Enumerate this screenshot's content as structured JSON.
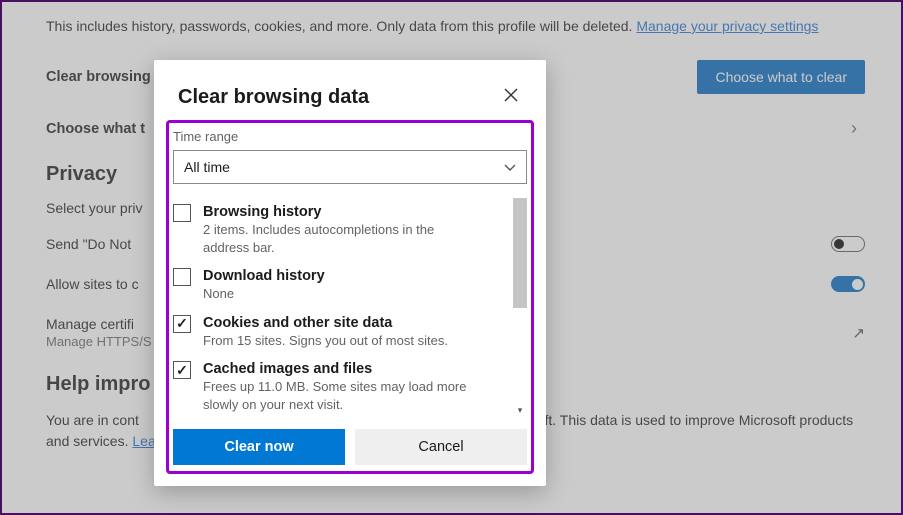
{
  "page": {
    "intro_text": "This includes history, passwords, cookies, and more. Only data from this profile will be deleted. ",
    "intro_link": "Manage your privacy settings",
    "row1_label": "Clear browsing",
    "row1_button": "Choose what to clear",
    "row2_label": "Choose what t",
    "privacy_heading": "Privacy",
    "privacy_sub": "Select your priv",
    "dnt_label": "Send \"Do Not ",
    "allow_label": "Allow sites to c",
    "manage_cert_label": "Manage certifi",
    "manage_cert_desc": "Manage HTTPS/S",
    "improve_heading": "Help impro",
    "improve_text1": "You are in cont",
    "improve_text_after": "oft. This data is used to improve Microsoft products and services. ",
    "improve_link": "Learn more about these settings"
  },
  "dialog": {
    "title": "Clear browsing data",
    "range_label": "Time range",
    "range_value": "All time",
    "options": [
      {
        "title": "Browsing history",
        "desc": "2 items. Includes autocompletions in the address bar.",
        "checked": false
      },
      {
        "title": "Download history",
        "desc": "None",
        "checked": false
      },
      {
        "title": "Cookies and other site data",
        "desc": "From 15 sites. Signs you out of most sites.",
        "checked": true
      },
      {
        "title": "Cached images and files",
        "desc": "Frees up 11.0 MB. Some sites may load more slowly on your next visit.",
        "checked": true
      }
    ],
    "clear_now": "Clear now",
    "cancel": "Cancel"
  }
}
